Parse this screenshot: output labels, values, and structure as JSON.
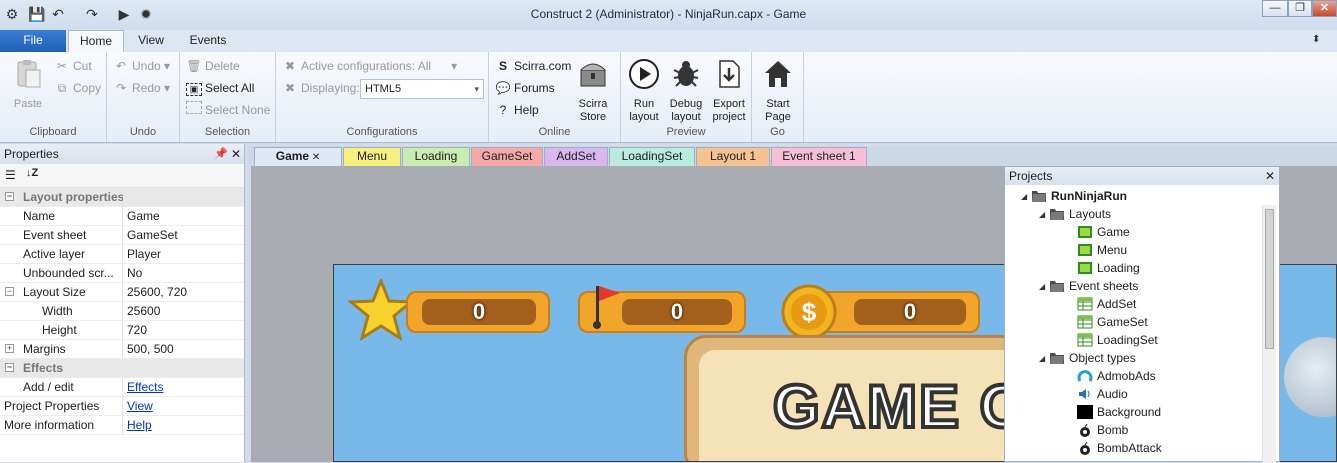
{
  "window": {
    "title": "Construct 2 (Administrator) - NinjaRun.capx - Game"
  },
  "ribbon_tabs": [
    "File",
    "Home",
    "View",
    "Events"
  ],
  "clipboard": {
    "paste": "Paste",
    "cut": "Cut",
    "copy": "Copy",
    "label": "Clipboard"
  },
  "undo": {
    "undo": "Undo",
    "redo": "Redo",
    "label": "Undo"
  },
  "selection": {
    "delete": "Delete",
    "select_all": "Select All",
    "select_none": "Select None",
    "label": "Selection"
  },
  "configurations": {
    "active": "Active configurations: All",
    "displaying_label": "Displaying:",
    "displaying_value": "HTML5",
    "label": "Configurations"
  },
  "online": {
    "scirra": "Scirra.com",
    "forums": "Forums",
    "help": "Help",
    "store_line1": "Scirra",
    "store_line2": "Store",
    "label": "Online"
  },
  "preview": {
    "run_1": "Run",
    "run_2": "layout",
    "debug_1": "Debug",
    "debug_2": "layout",
    "export_1": "Export",
    "export_2": "project",
    "label": "Preview"
  },
  "go": {
    "start_1": "Start",
    "start_2": "Page",
    "label": "Go"
  },
  "properties": {
    "title": "Properties",
    "rows": [
      {
        "k": "Layout properties",
        "section": true
      },
      {
        "k": "Name",
        "v": "Game"
      },
      {
        "k": "Event sheet",
        "v": "GameSet"
      },
      {
        "k": "Active layer",
        "v": "Player"
      },
      {
        "k": "Unbounded scr...",
        "v": "No"
      },
      {
        "k": "Layout Size",
        "v": "25600, 720"
      },
      {
        "k": "Width",
        "v": "25600"
      },
      {
        "k": "Height",
        "v": "720"
      },
      {
        "k": "Margins",
        "v": "500, 500"
      },
      {
        "k": "Effects",
        "section": true
      },
      {
        "k": "Add / edit",
        "v": "Effects"
      },
      {
        "k": "Project Properties",
        "v": "View"
      },
      {
        "k": "More information",
        "v": "Help"
      }
    ]
  },
  "doc_tabs": [
    {
      "label": "Game",
      "color": "#dfe8f4"
    },
    {
      "label": "Menu",
      "color": "#f7f081"
    },
    {
      "label": "Loading",
      "color": "#c9ecb0"
    },
    {
      "label": "GameSet",
      "color": "#f5a9a9"
    },
    {
      "label": "AddSet",
      "color": "#d9b8ef"
    },
    {
      "label": "LoadingSet",
      "color": "#b9ecdf"
    },
    {
      "label": "Layout 1",
      "color": "#f6c28f"
    },
    {
      "label": "Event sheet 1",
      "color": "#f5c0d8"
    }
  ],
  "game_hud": {
    "score": "0",
    "flag": "0",
    "coins": "0",
    "banner": "GAME O"
  },
  "projects": {
    "title": "Projects",
    "root": "RunNinjaRun",
    "layouts_label": "Layouts",
    "layouts": [
      "Game",
      "Menu",
      "Loading"
    ],
    "events_label": "Event sheets",
    "events": [
      "AddSet",
      "GameSet",
      "LoadingSet"
    ],
    "objects_label": "Object types",
    "objects": [
      "AdmobAds",
      "Audio",
      "Background",
      "Bomb",
      "BombAttack"
    ]
  }
}
